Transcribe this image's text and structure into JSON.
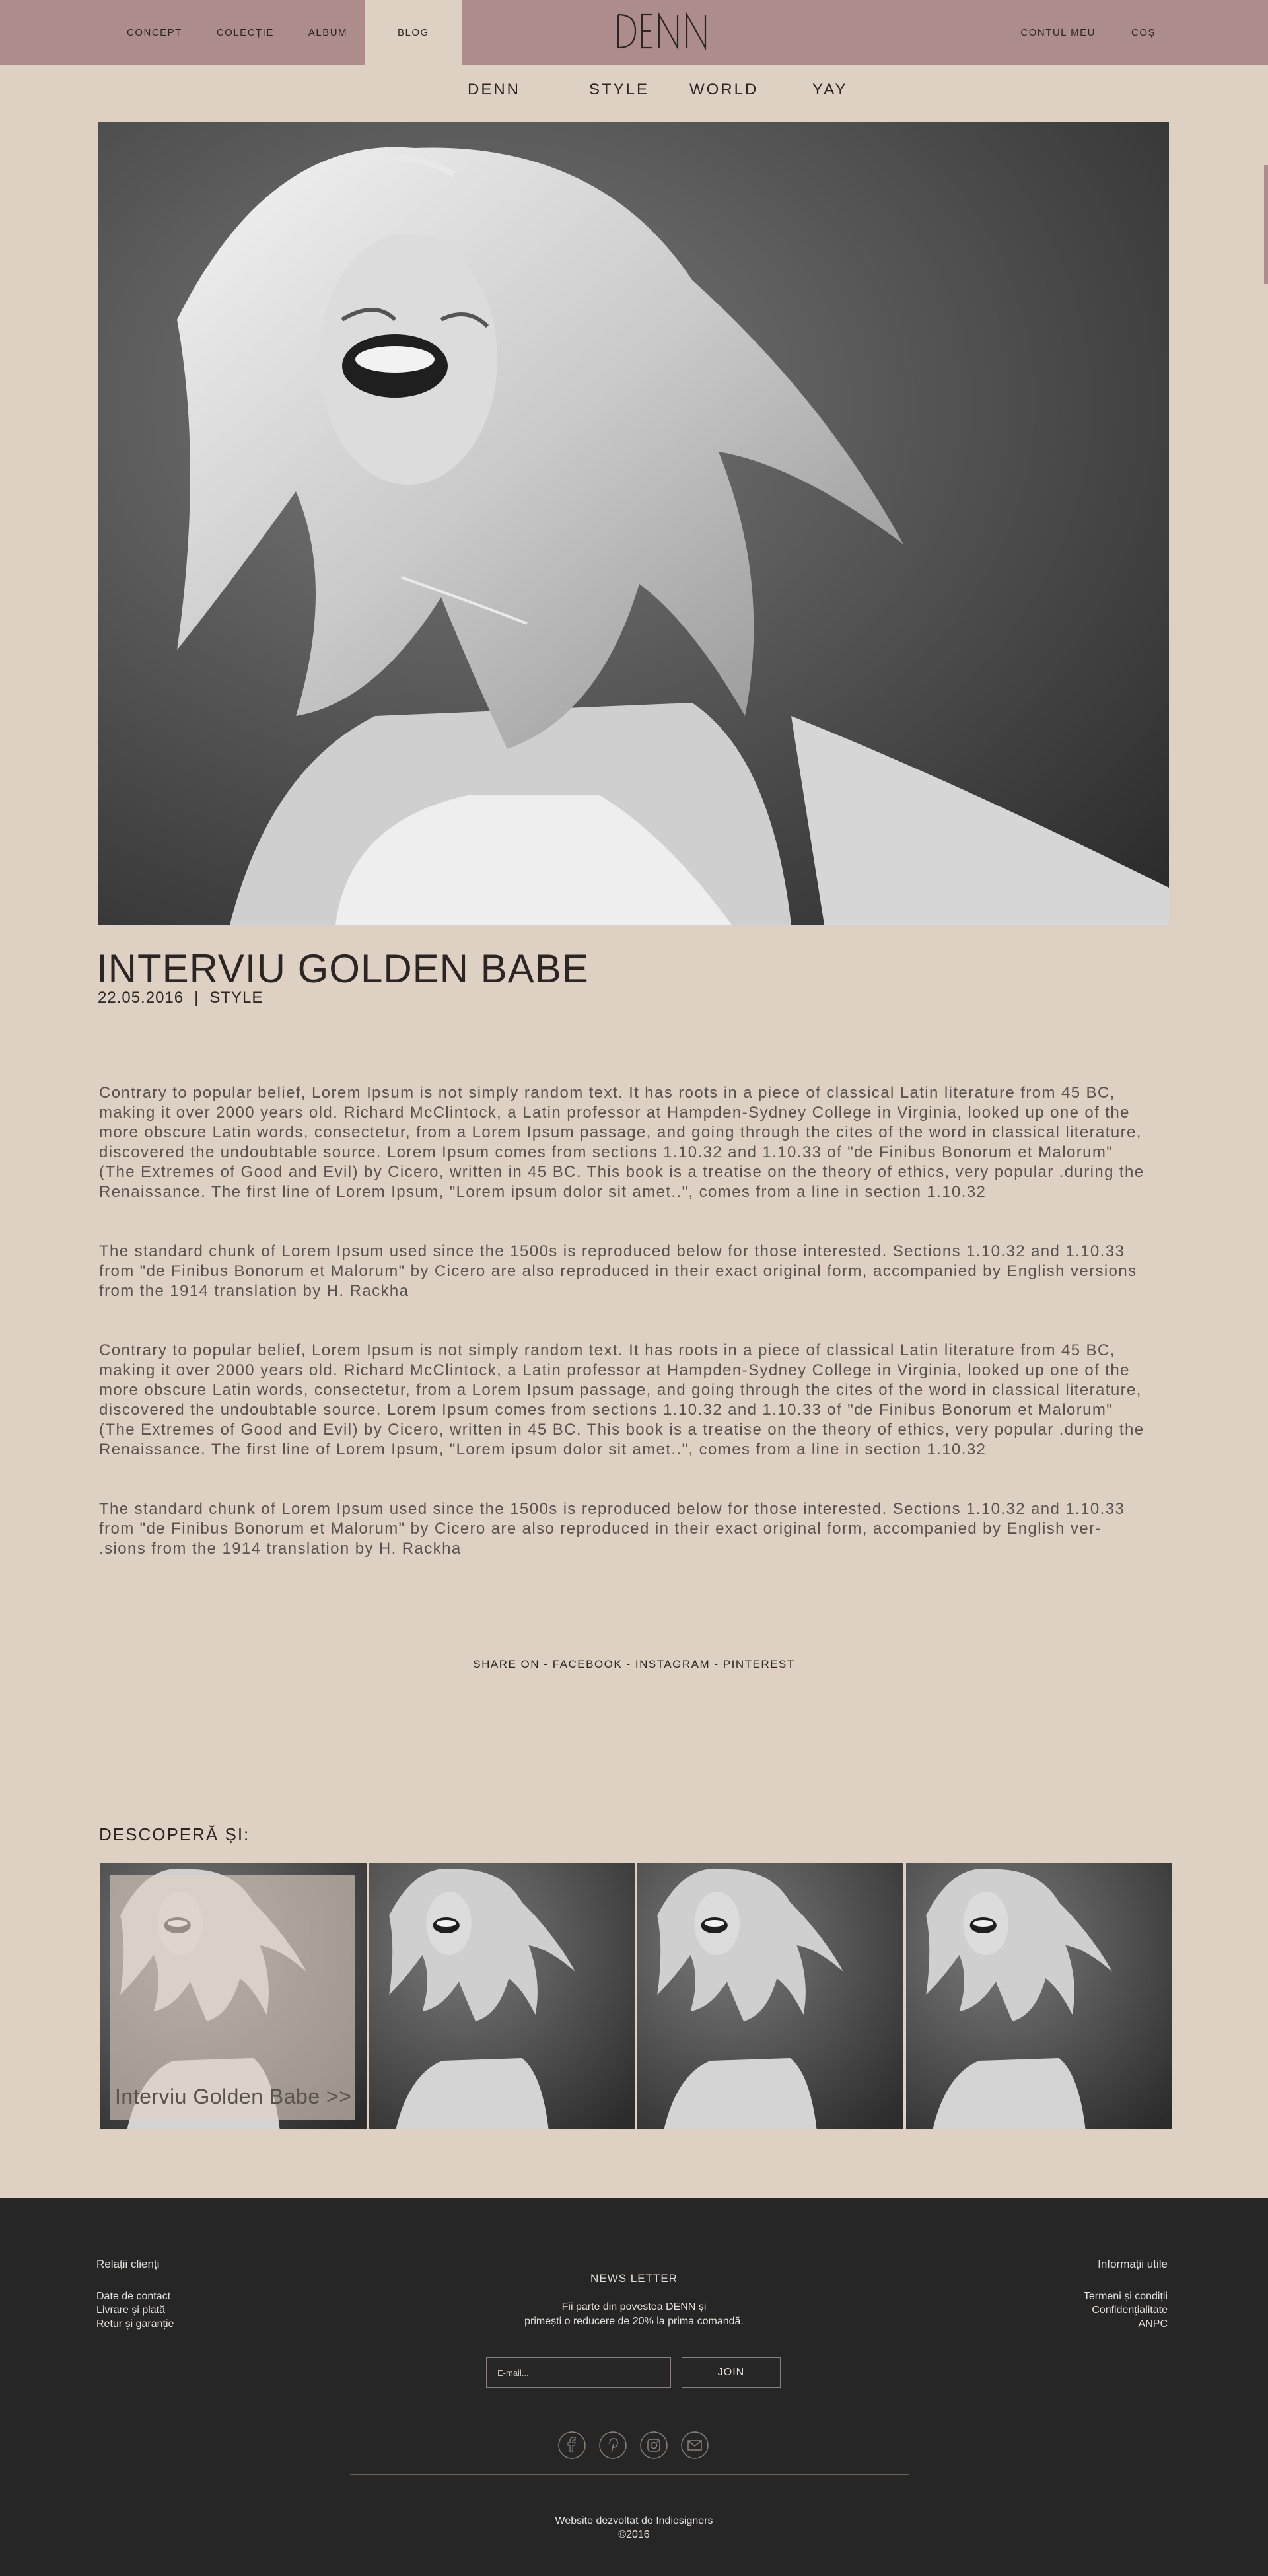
{
  "header": {
    "nav_left": [
      "CONCEPT",
      "COLECȚIE",
      "ALBUM",
      "BLOG"
    ],
    "logo_text": "DENN",
    "nav_right": [
      "CONTUL MEU",
      "COȘ"
    ]
  },
  "categories": [
    "DENN",
    "STYLE",
    "WORLD",
    "YAY"
  ],
  "post": {
    "title": "INTERVIU GOLDEN BABE",
    "date": "22.05.2016",
    "separator": "|",
    "category": "STYLE",
    "paragraphs": [
      "Contrary to popular belief, Lorem Ipsum is not simply random text. It has roots in a piece of classical Latin literature from 45 BC, making it over 2000 years old. Richard McClintock, a Latin professor at Hampden-Sydney College in Virginia, looked up one of the more obscure Latin words, consectetur, from a Lorem Ipsum passage, and going through the cites of the word in classical literature, discovered the undoubtable source. Lorem Ipsum comes from sections 1.10.32 and 1.10.33 of \"de Finibus Bonorum et Malorum\" (The Extremes of Good and Evil) by Cicero, written in 45 BC. This book is a treatise on the theory of ethics, very popular .during the Renaissance. The first line of Lorem Ipsum, \"Lorem ipsum dolor sit amet..\", comes from a line in section 1.10.32",
      "The standard chunk of Lorem Ipsum used since the 1500s is reproduced below for those interested. Sections 1.10.32 and 1.10.33 from \"de Finibus Bonorum et Malorum\" by Cicero are also reproduced in their exact original form, accompanied by English versions from the 1914 translation by H. Rackha",
      "Contrary to popular belief, Lorem Ipsum is not simply random text. It has roots in a piece of classical Latin literature from 45 BC, making it over 2000 years old. Richard McClintock, a Latin professor at Hampden-Sydney College in Virginia, looked up one of the more obscure Latin words, consectetur, from a Lorem Ipsum passage, and going through the cites of the word in classical literature, discovered the undoubtable source. Lorem Ipsum comes from sections 1.10.32 and 1.10.33 of \"de Finibus Bonorum et Malorum\" (The Extremes of Good and Evil) by Cicero, written in 45 BC. This book is a treatise on the theory of ethics, very popular .during the Renaissance. The first line of Lorem Ipsum, \"Lorem ipsum dolor sit amet..\", comes from a line in section 1.10.32",
      "The standard chunk of Lorem Ipsum used since the 1500s is reproduced below for those interested. Sections 1.10.32 and 1.10.33 from \"de Finibus Bonorum et Malorum\" by Cicero are also reproduced in their exact original form, accompanied by English ver- .sions from the 1914 translation by H. Rackha"
    ]
  },
  "share": {
    "prefix": "SHARE ON",
    "dash": "-",
    "links": [
      "FACEBOOK",
      "INSTAGRAM",
      "PINTEREST"
    ]
  },
  "discover": {
    "title": "DESCOPERĂ ȘI:",
    "first_caption": "Interviu Golden Babe >>"
  },
  "footer": {
    "left_heading": "Relații clienți",
    "left_links": [
      "Date de contact",
      "Livrare și plată",
      "Retur și garanție"
    ],
    "newsletter_title": "NEWS LETTER",
    "newsletter_line1": "Fii parte din povestea DENN și",
    "newsletter_line2": "primești o reducere de 20% la prima comandă.",
    "email_placeholder": "E-mail...",
    "join_label": "JOIN",
    "right_heading": "Informații utile",
    "right_links": [
      "Termeni și condiții",
      "Confidențialitate",
      "ANPC"
    ],
    "credit_line1": "Website dezvoltat de Indiesigners",
    "credit_line2": "©2016",
    "social_icons": [
      "facebook-icon",
      "pinterest-icon",
      "instagram-icon",
      "mail-icon"
    ]
  },
  "colors": {
    "header_bg": "#ad8d8b",
    "page_bg": "#ded1c4",
    "footer_bg": "#262626",
    "text_dark": "#2b2623"
  }
}
